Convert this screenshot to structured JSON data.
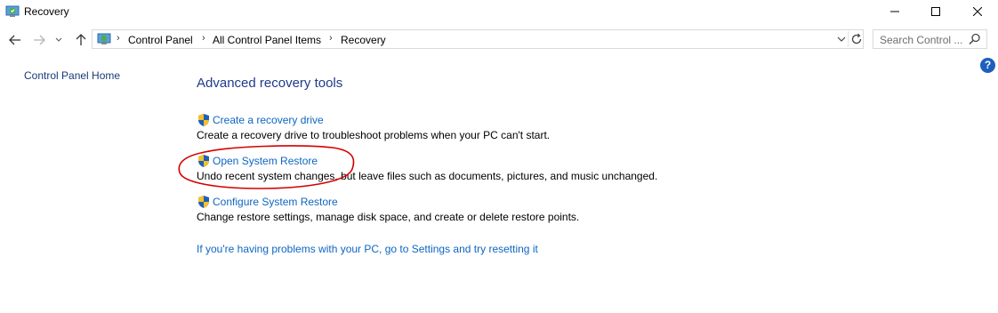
{
  "window": {
    "title": "Recovery"
  },
  "address_bar": {
    "breadcrumbs": [
      "Control Panel",
      "All Control Panel Items",
      "Recovery"
    ]
  },
  "search": {
    "placeholder": "Search Control ..."
  },
  "sidebar": {
    "home_link": "Control Panel Home"
  },
  "main": {
    "heading": "Advanced recovery tools",
    "tools": [
      {
        "label": "Create a recovery drive",
        "description": "Create a recovery drive to troubleshoot problems when your PC can't start."
      },
      {
        "label": "Open System Restore",
        "description": "Undo recent system changes, but leave files such as documents, pictures, and music unchanged."
      },
      {
        "label": "Configure System Restore",
        "description": "Change restore settings, manage disk space, and create or delete restore points."
      }
    ],
    "reset_link": "If you're having problems with your PC, go to Settings and try resetting it"
  },
  "colors": {
    "link": "#0e66c1",
    "heading": "#1e3a8a",
    "annotation": "#d40000"
  }
}
